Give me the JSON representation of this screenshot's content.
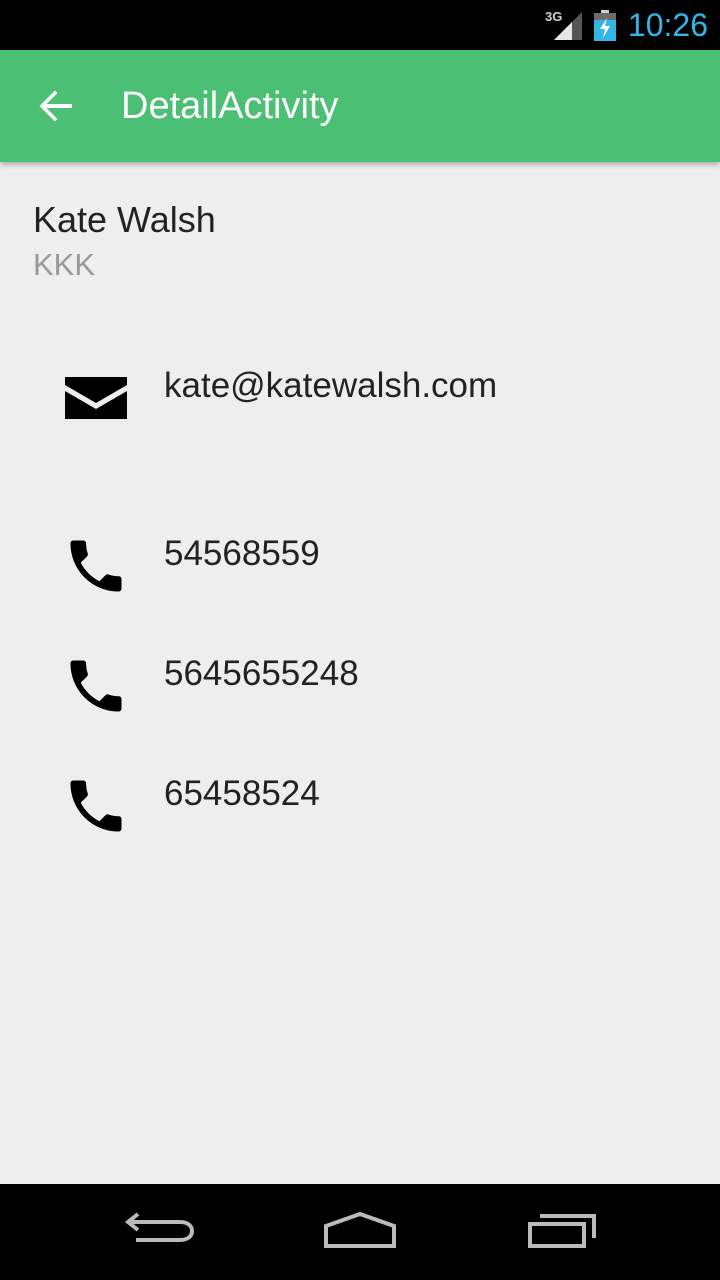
{
  "status_bar": {
    "network": "3G",
    "time": "10:26"
  },
  "app_bar": {
    "title": "DetailActivity",
    "back_icon": "arrow-back-icon"
  },
  "contact": {
    "name": "Kate Walsh",
    "subtitle": "KKK"
  },
  "email": {
    "icon": "email-icon",
    "value": "kate@katewalsh.com"
  },
  "phones": [
    {
      "icon": "phone-icon",
      "value": "54568559"
    },
    {
      "icon": "phone-icon",
      "value": "5645655248"
    },
    {
      "icon": "phone-icon",
      "value": "65458524"
    }
  ],
  "nav_bar": {
    "buttons": [
      "back-icon",
      "home-icon",
      "recents-icon"
    ]
  },
  "colors": {
    "app_bar": "#4bbf73",
    "time": "#33b5e5",
    "background": "#eeeeee"
  }
}
